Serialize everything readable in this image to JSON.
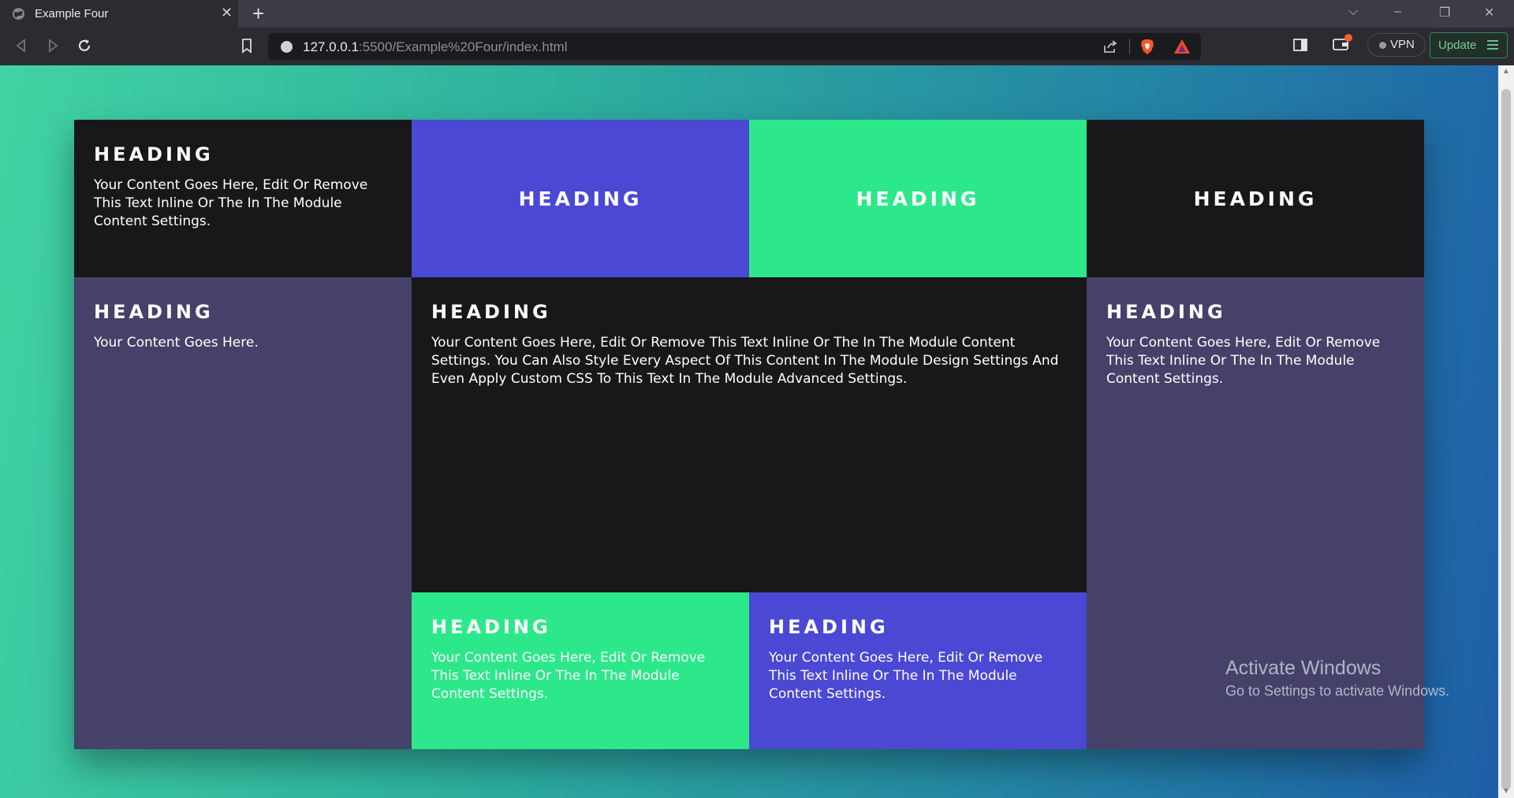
{
  "browser": {
    "tab_title": "Example Four",
    "url_host": "127.0.0.1",
    "url_rest": ":5500/Example%20Four/index.html",
    "vpn_label": "VPN",
    "update_label": "Update"
  },
  "cells": {
    "top_left": {
      "heading": "HEADING",
      "text": "Your Content Goes Here, Edit Or Remove This Text Inline Or The In The Module Content Settings."
    },
    "top_blue": {
      "heading": "HEADING"
    },
    "top_green": {
      "heading": "HEADING"
    },
    "top_right": {
      "heading": "HEADING"
    },
    "left_purple": {
      "heading": "HEADING",
      "text": "Your Content Goes Here."
    },
    "center_dark": {
      "heading": "HEADING",
      "text": "Your Content Goes Here, Edit Or Remove This Text Inline Or The In The Module Content Settings. You Can Also Style Every Aspect Of This Content In The Module Design Settings And Even Apply Custom CSS To This Text In The Module Advanced Settings."
    },
    "right_purple": {
      "heading": "HEADING",
      "text": "Your Content Goes Here, Edit Or Remove This Text Inline Or The In The Module Content Settings."
    },
    "bottom_green": {
      "heading": "HEADING",
      "text": "Your Content Goes Here, Edit Or Remove This Text Inline Or The In The Module Content Settings."
    },
    "bottom_blue": {
      "heading": "HEADING",
      "text": "Your Content Goes Here, Edit Or Remove This Text Inline Or The In The Module Content Settings."
    }
  },
  "watermark": {
    "line1": "Activate Windows",
    "line2": "Go to Settings to activate Windows."
  },
  "colors": {
    "dark": "#18181a",
    "blue": "#4b48d4",
    "green": "#2de88a",
    "purple": "#454168"
  }
}
